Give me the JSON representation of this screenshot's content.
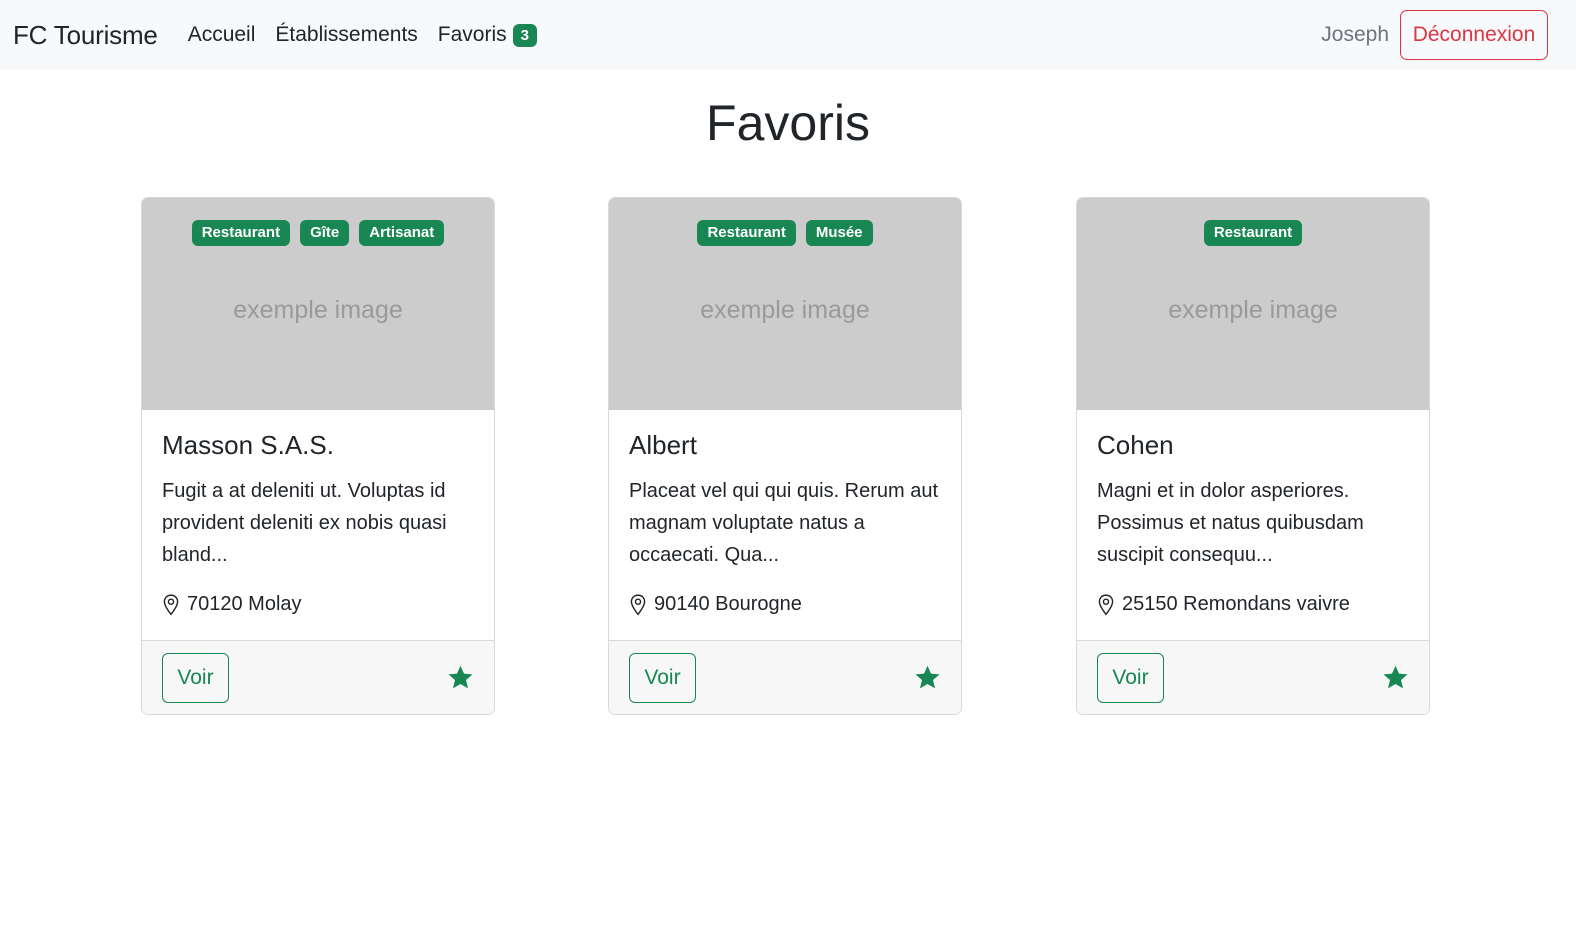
{
  "navbar": {
    "brand": "FC Tourisme",
    "links": [
      "Accueil",
      "Établissements",
      "Favoris"
    ],
    "favorites_count": "3",
    "username": "Joseph",
    "logout_label": "Déconnexion"
  },
  "page": {
    "title": "Favoris"
  },
  "cards": [
    {
      "tags": [
        "Restaurant",
        "Gîte",
        "Artisanat"
      ],
      "image_label": "exemple image",
      "title": "Masson S.A.S.",
      "description": "Fugit a at deleniti ut. Voluptas id provident deleniti ex nobis quasi bland...",
      "location": "70120 Molay",
      "view_label": "Voir"
    },
    {
      "tags": [
        "Restaurant",
        "Musée"
      ],
      "image_label": "exemple image",
      "title": "Albert",
      "description": "Placeat vel qui qui quis. Rerum aut magnam voluptate natus a occaecati. Qua...",
      "location": "90140 Bourogne",
      "view_label": "Voir"
    },
    {
      "tags": [
        "Restaurant"
      ],
      "image_label": "exemple image",
      "title": "Cohen",
      "description": "Magni et in dolor asperiores. Possimus et natus quibusdam suscipit consequu...",
      "location": "25150 Remondans vaivre",
      "view_label": "Voir"
    }
  ],
  "colors": {
    "accent": "#198754",
    "danger": "#dc3545",
    "navbar_bg": "#f8f9fa",
    "image_placeholder": "#cccccc"
  },
  "icons": {
    "location": "geo-pin-icon",
    "favorite": "star-filled-icon"
  }
}
